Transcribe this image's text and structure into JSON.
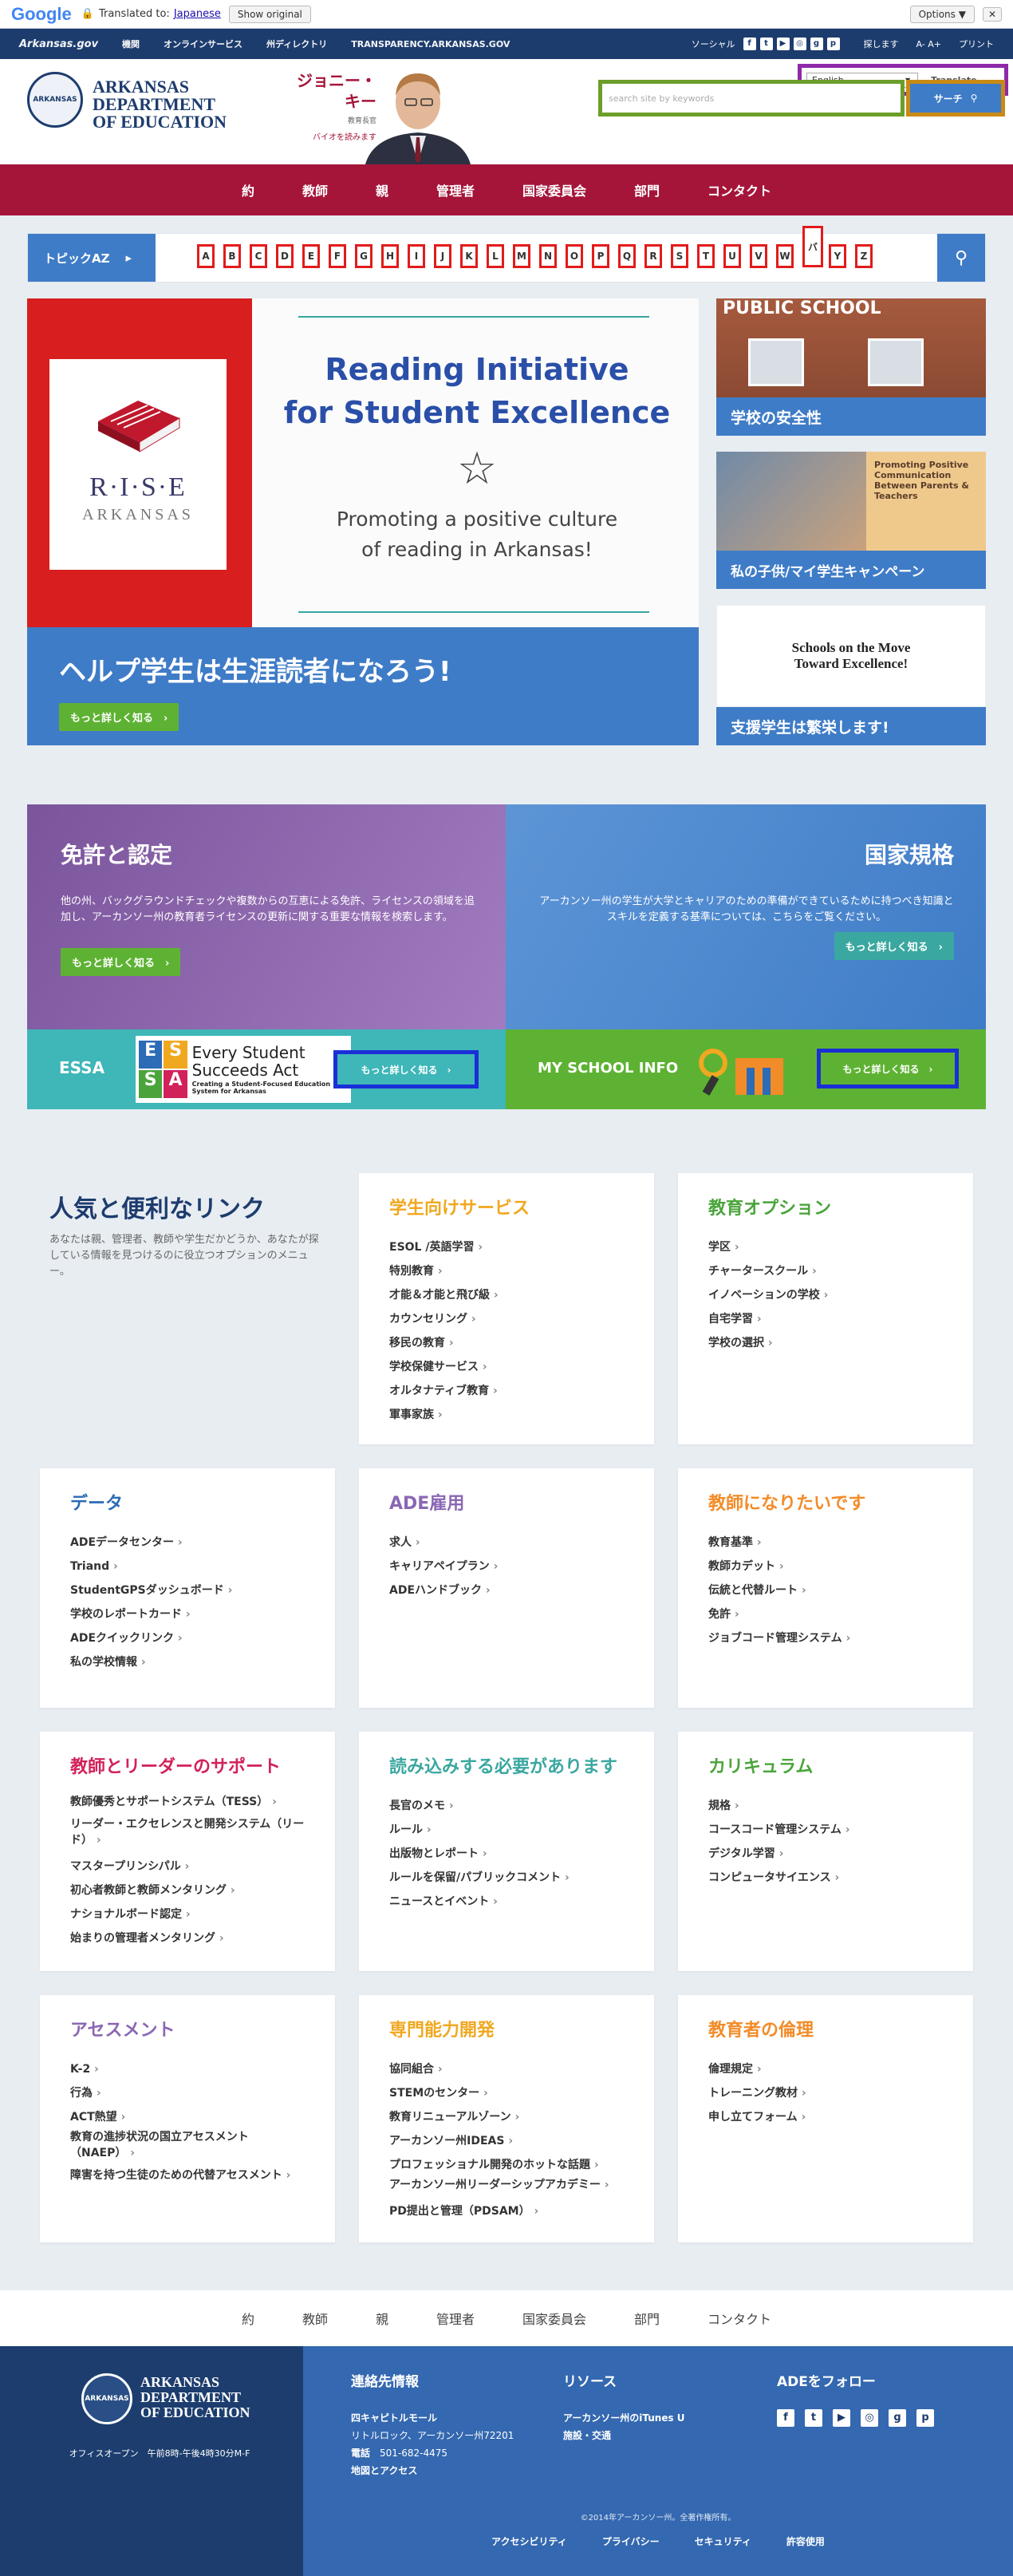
{
  "translate_bar": {
    "logo": "Google",
    "translated_to": "Translated to:",
    "language": "Japanese",
    "show_original": "Show original",
    "options": "Options ▼",
    "close": "✕"
  },
  "state_bar": {
    "site": "Arkansas.gov",
    "links": [
      "機関",
      "オンラインサービス",
      "州ディレクトリ",
      "TRANSPARENCY.ARKANSAS.GOV"
    ],
    "social": "ソーシャル",
    "right_links": [
      "探します",
      "A- A+",
      "プリント"
    ]
  },
  "header": {
    "brand_line1": "ARKANSAS",
    "brand_line2": "DEPARTMENT",
    "brand_line3": "OF EDUCATION",
    "seal_text": "ARKANSAS",
    "commissioner_name": "ジョニー・キー",
    "commissioner_title": "教育長官",
    "bio_link": "バイオを読みます",
    "language_select": "English",
    "translate_label": "Translate",
    "search_placeholder": "search site by keywords",
    "search_button": "サーチ"
  },
  "nav": {
    "items": [
      "約",
      "教師",
      "親",
      "管理者",
      "国家委員会",
      "部門",
      "コンタクト"
    ]
  },
  "az": {
    "tab_label": "トピックAZ",
    "letters": [
      "A",
      "B",
      "C",
      "D",
      "E",
      "F",
      "G",
      "H",
      "I",
      "J",
      "K",
      "L",
      "M",
      "N",
      "O",
      "P",
      "Q",
      "R",
      "S",
      "T",
      "U",
      "V",
      "W",
      "バ",
      "Y",
      "Z"
    ]
  },
  "hero": {
    "rise_title": "R·I·S·E",
    "rise_sub": "ARKANSAS",
    "headline_1": "Reading Initiative",
    "headline_2": "for Student Excellence",
    "tagline_1": "Promoting a positive culture",
    "tagline_2": "of reading in Arkansas!",
    "banner": "ヘルプ学生は生涯読者になろう!",
    "learn_more": "もっと詳しく知る"
  },
  "side_cards": [
    {
      "label": "学校の安全性",
      "img_text": "PUBLIC SCHOOL"
    },
    {
      "label": "私の子供/マイ学生キャンペーン",
      "img_text": "Promoting Positive Communication Between Parents & Teachers"
    },
    {
      "label": "支援学生は繁栄します!",
      "img_text": "Schools on the Move Toward Excellence!"
    }
  ],
  "promos": {
    "licensure": {
      "title": "免許と認定",
      "text": "他の州、バックグラウンドチェックや複数からの互恵による免許、ライセンスの領域を追加し、アーカンソー州の教育者ライセンスの更新に関する重要な情報を検索します。",
      "button": "もっと詳しく知る"
    },
    "standards": {
      "title": "国家規格",
      "text": "アーカンソー州の学生が大学とキャリアのための準備ができているために持つべき知識とスキルを定義する基準については、こちらをご覧ください。",
      "button": "もっと詳しく知る"
    },
    "essa": {
      "title": "ESSA",
      "logo_text": "Every Student Succeeds Act",
      "logo_sub": "Creating a Student-Focused Education System for Arkansas",
      "button": "もっと詳しく知る"
    },
    "msi": {
      "title": "MY SCHOOL INFO",
      "button": "もっと詳しく知る"
    }
  },
  "quicklinks": {
    "title": "人気と便利なリンク",
    "desc": "あなたは親、管理者、教師や学生だかどうか、あなたが探している情報を見つけるのに役立つオプションのメニュー。",
    "cards": [
      {
        "title": "学生向けサービス",
        "color": "#f0a820",
        "items": [
          "ESOL /英語学習",
          "特別教育",
          "才能＆才能と飛び級",
          "カウンセリング",
          "移民の教育",
          "学校保健サービス",
          "オルタナティブ教育",
          "軍事家族"
        ]
      },
      {
        "title": "教育オプション",
        "color": "#4aa43b",
        "items": [
          "学区",
          "チャータースクール",
          "イノベーションの学校",
          "自宅学習",
          "学校の選択"
        ]
      },
      {
        "title": "データ",
        "color": "#2c6bb5",
        "items": [
          "ADEデータセンター",
          "Triand",
          "StudentGPSダッシュボード",
          "学校のレポートカード",
          "ADEクイックリンク",
          "私の学校情報"
        ]
      },
      {
        "title": "ADE雇用",
        "color": "#8a67b3",
        "items": [
          "求人",
          "キャリアペイプラン",
          "ADEハンドブック"
        ]
      },
      {
        "title": "教師になりたいです",
        "color": "#f28c28",
        "items": [
          "教育基準",
          "教師カデット",
          "伝統と代替ルート",
          "免許",
          "ジョブコード管理システム"
        ]
      },
      {
        "title": "教師とリーダーのサポート",
        "color": "#d2225a",
        "items": [
          "教師優秀とサポートシステム（TESS）",
          "リーダー・エクセレンスと開発システム（リード）",
          "マスタープリンシパル",
          "初心者教師と教師メンタリング",
          "ナショナルボード認定",
          "始まりの管理者メンタリング"
        ]
      },
      {
        "title": "読み込みする必要があります",
        "color": "#3aa7a0",
        "items": [
          "長官のメモ",
          "ルール",
          "出版物とレポート",
          "ルールを保留/パブリックコメント",
          "ニュースとイベント"
        ]
      },
      {
        "title": "カリキュラム",
        "color": "#4aa43b",
        "items": [
          "規格",
          "コースコード管理システム",
          "デジタル学習",
          "コンピュータサイエンス"
        ]
      },
      {
        "title": "アセスメント",
        "color": "#8a67b3",
        "items": [
          "K-2",
          "行為",
          "ACT熱望",
          "教育の進捗状況の国立アセスメント（NAEP）",
          "障害を持つ生徒のための代替アセスメント"
        ]
      },
      {
        "title": "専門能力開発",
        "color": "#f0a820",
        "items": [
          "協同組合",
          "STEMのセンター",
          "教育リニューアルゾーン",
          "アーカンソー州IDEAS",
          "プロフェッショナル開発のホットな話題",
          "アーカンソー州リーダーシップアカデミー",
          "PD提出と管理（PDSAM）"
        ]
      },
      {
        "title": "教育者の倫理",
        "color": "#f28c28",
        "items": [
          "倫理規定",
          "トレーニング教材",
          "申し立てフォーム"
        ]
      }
    ]
  },
  "footer_nav": [
    "約",
    "教師",
    "親",
    "管理者",
    "国家委員会",
    "部門",
    "コンタクト"
  ],
  "footer": {
    "hours": "オフィスオープン　午前8時-午後4時30分M-F",
    "contact_title": "連絡先情報",
    "address_1": "四キャピトルモール",
    "address_2": "リトルロック、アーカンソー州72201",
    "phone_label": "電話",
    "phone": "501-682-4475",
    "map_link": "地図とアクセス",
    "resources_title": "リソース",
    "resources": [
      "アーカンソー州のiTunes U",
      "施設・交通"
    ],
    "follow_title": "ADEをフォロー",
    "copyright": "©2014年アーカンソー州。全著作権所有。",
    "bottom_links": [
      "アクセシビリティ",
      "プライバシー",
      "セキュリティ",
      "許容使用"
    ]
  }
}
